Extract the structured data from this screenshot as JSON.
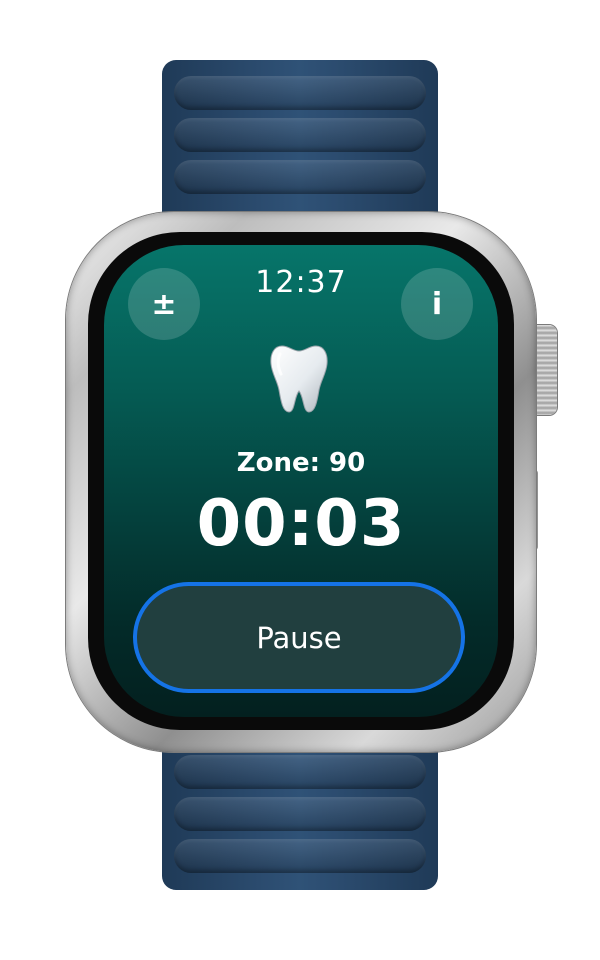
{
  "status_bar": {
    "time": "12:37"
  },
  "toolbar": {
    "adjust_icon_glyph": "±",
    "info_icon_glyph": "i"
  },
  "session": {
    "zone_text": "Zone: 90",
    "timer_text": "00:03"
  },
  "controls": {
    "pause_label": "Pause"
  },
  "icons": [
    "plus-minus-icon",
    "info-icon",
    "tooth-icon"
  ],
  "colors": {
    "screen_top": "#06756a",
    "screen_bottom": "#03201f",
    "pause_button_fill": "#213f3f",
    "focus_ring": "#1573e6",
    "band": "#2b4b6e"
  }
}
